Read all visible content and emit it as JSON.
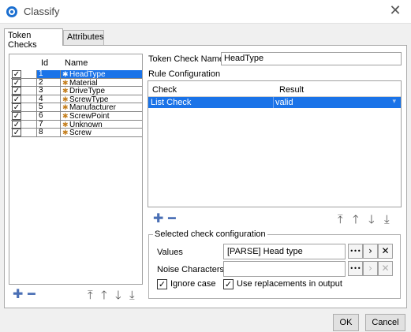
{
  "window": {
    "title": "Classify",
    "icon": "app-logo-icon",
    "close_glyph": "✕"
  },
  "tabs": [
    {
      "label": "Token Checks",
      "active": true
    },
    {
      "label": "Attributes",
      "active": false
    }
  ],
  "token_table": {
    "headers": {
      "check": "",
      "id": "Id",
      "name": "Name"
    },
    "rows": [
      {
        "checked": true,
        "id": "1",
        "name": "HeadType",
        "selected": true
      },
      {
        "checked": true,
        "id": "2",
        "name": "Material",
        "selected": false
      },
      {
        "checked": true,
        "id": "3",
        "name": "DriveType",
        "selected": false
      },
      {
        "checked": true,
        "id": "4",
        "name": "ScrewType",
        "selected": false
      },
      {
        "checked": true,
        "id": "5",
        "name": "Manufacturer",
        "selected": false
      },
      {
        "checked": true,
        "id": "6",
        "name": "ScrewPoint",
        "selected": false
      },
      {
        "checked": true,
        "id": "7",
        "name": "Unknown",
        "selected": false
      },
      {
        "checked": true,
        "id": "8",
        "name": "Screw",
        "selected": false
      }
    ],
    "check_glyph": "✓",
    "row_icon": "gear-icon"
  },
  "left_toolbar": {
    "add": "✚",
    "remove": "━",
    "top": "⤒",
    "up": "🡑",
    "down": "🡓",
    "bottom": "⤓"
  },
  "token_check_name": {
    "label": "Token Check Name",
    "value": "HeadType"
  },
  "rule_configuration": {
    "label": "Rule Configuration",
    "headers": {
      "check": "Check",
      "result": "Result"
    },
    "rows": [
      {
        "check": "List Check",
        "result": "valid",
        "selected": true
      }
    ],
    "chevron": "▾"
  },
  "right_toolbar": {
    "add": "✚",
    "remove": "━",
    "top": "⤒",
    "up": "🡑",
    "down": "🡓",
    "bottom": "⤓"
  },
  "selected_check": {
    "legend": "Selected check configuration",
    "values_label": "Values",
    "values_value": "[PARSE] Head type",
    "noise_label": "Noise Characters",
    "noise_value": "",
    "ellipsis": "•••",
    "arrow": "›",
    "clear": "✕",
    "ignore_case": {
      "label": "Ignore case",
      "checked": true
    },
    "use_replacements": {
      "label": "Use replacements in output",
      "checked": true
    }
  },
  "footer": {
    "ok": "OK",
    "cancel": "Cancel"
  }
}
